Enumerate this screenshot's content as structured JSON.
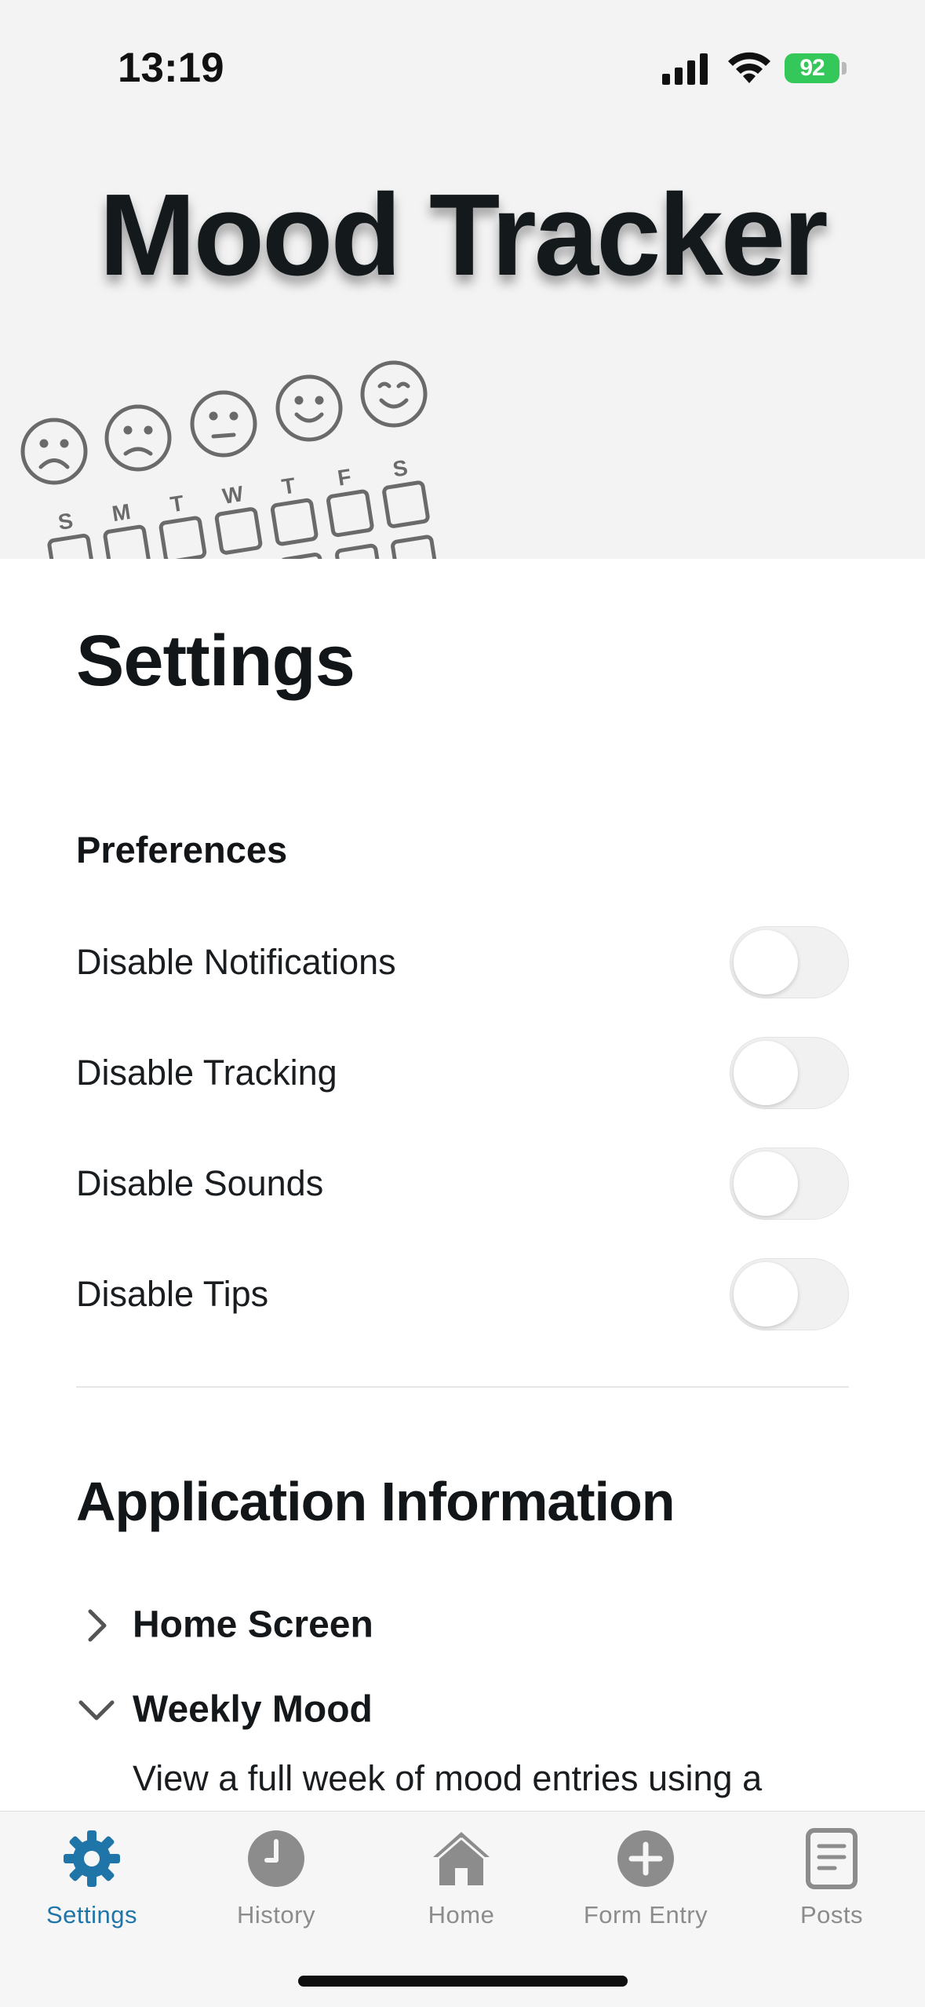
{
  "status_bar": {
    "time": "13:19",
    "battery": "92",
    "icons": [
      "signal-icon",
      "wifi-icon",
      "battery-icon"
    ]
  },
  "header": {
    "app_title": "Mood Tracker",
    "illustration_days": [
      "S",
      "M",
      "T",
      "W",
      "T",
      "F",
      "S"
    ],
    "illustration_moods": [
      "sad-face-icon",
      "frown-face-icon",
      "neutral-face-icon",
      "smile-face-icon",
      "wink-face-icon"
    ]
  },
  "settings": {
    "title": "Settings",
    "preferences": {
      "heading": "Preferences",
      "items": [
        {
          "label": "Disable Notifications",
          "on": false
        },
        {
          "label": "Disable Tracking",
          "on": false
        },
        {
          "label": "Disable Sounds",
          "on": false
        },
        {
          "label": "Disable Tips",
          "on": false
        }
      ]
    },
    "app_info": {
      "heading": "Application Information",
      "items": [
        {
          "label": "Home Screen",
          "expanded": false
        },
        {
          "label": "Weekly Mood",
          "expanded": true,
          "description": "View a full week of mood entries using a"
        }
      ]
    }
  },
  "tabbar": {
    "accent": "#1f74a8",
    "inactive": "#8c8c8c",
    "tabs": [
      {
        "label": "Settings",
        "icon": "gear-icon",
        "active": true
      },
      {
        "label": "History",
        "icon": "clock-icon",
        "active": false
      },
      {
        "label": "Home",
        "icon": "house-icon",
        "active": false
      },
      {
        "label": "Form Entry",
        "icon": "plus-circle-icon",
        "active": false
      },
      {
        "label": "Posts",
        "icon": "document-icon",
        "active": false
      }
    ]
  }
}
